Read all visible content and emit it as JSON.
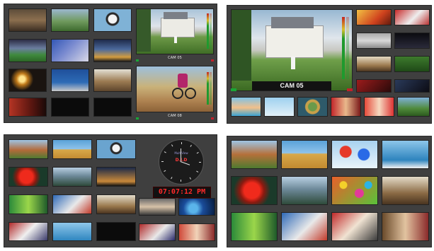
{
  "colors": {
    "panel_bg": "#3f3f3f",
    "tally_green": "#1aa637",
    "tally_red": "#c2202a",
    "clock_red": "#ff2a2a"
  },
  "panel1": {
    "big_upper_label": "CAM 05",
    "big_lower_label": "CAM 08"
  },
  "panel2": {
    "program_label": "CAM 05"
  },
  "panel3": {
    "clock_title": "MultiView",
    "clock_sub": "D.I.D",
    "digital_time": "07:07:12 PM"
  }
}
